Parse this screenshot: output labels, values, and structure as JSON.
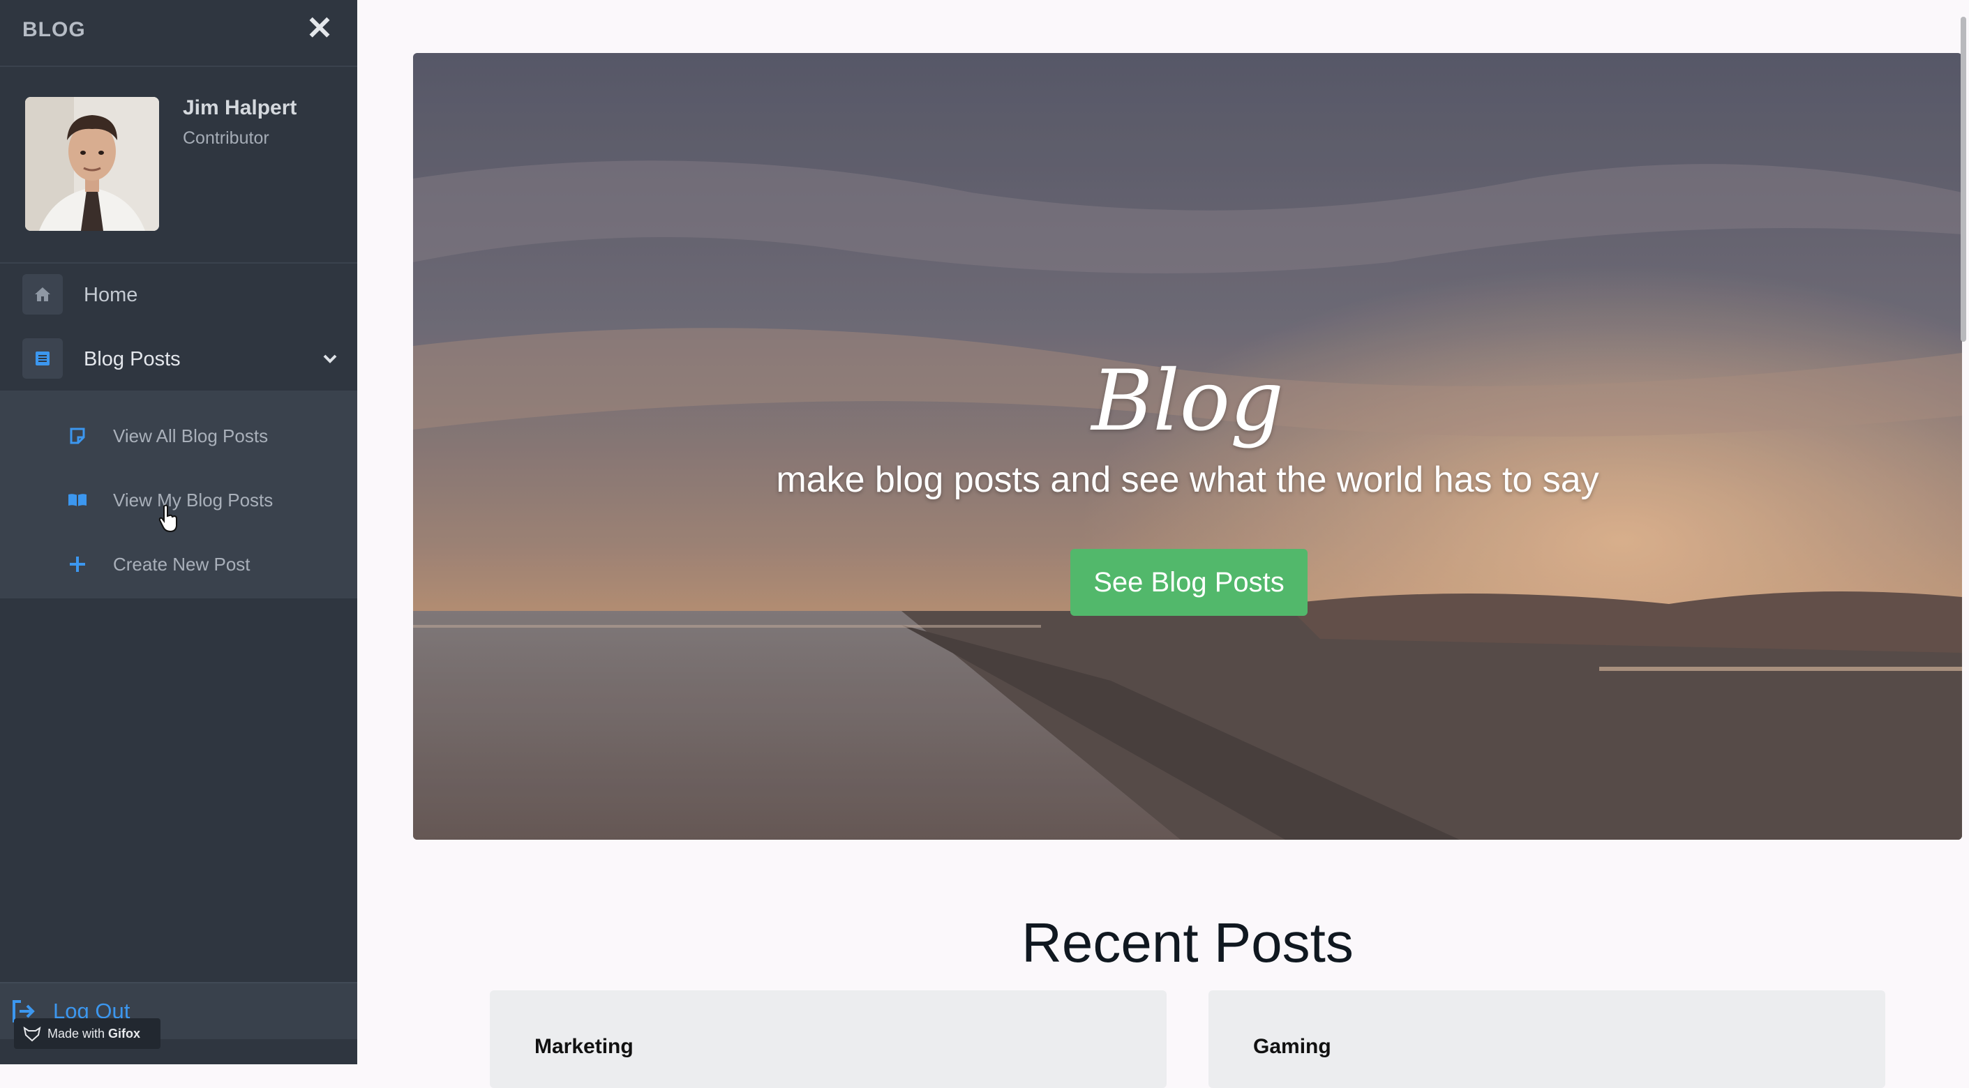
{
  "sidebar": {
    "brand": "BLOG",
    "close_icon": "close-icon",
    "profile": {
      "name": "Jim Halpert",
      "role": "Contributor"
    },
    "nav": [
      {
        "label": "Home",
        "icon": "home-icon"
      },
      {
        "label": "Blog Posts",
        "icon": "list-icon",
        "expanded": true
      }
    ],
    "submenu": [
      {
        "label": "View All Blog Posts",
        "icon": "note-icon"
      },
      {
        "label": "View My Blog Posts",
        "icon": "book-icon"
      },
      {
        "label": "Create New Post",
        "icon": "plus-icon"
      }
    ],
    "logout": {
      "label": "Log Out",
      "icon": "sign-out-icon"
    },
    "watermark": {
      "prefix": "Made with",
      "brand": "Gifox"
    }
  },
  "hero": {
    "title": "Blog",
    "subtitle": "make blog posts and see what the world has to say",
    "button_label": "See Blog Posts"
  },
  "recent": {
    "title": "Recent Posts",
    "cards": [
      {
        "category": "Marketing"
      },
      {
        "category": "Gaming"
      }
    ]
  },
  "colors": {
    "sidebar_bg": "#2f3640",
    "accent_blue": "#3c97ef",
    "button_green": "#52b86b",
    "page_bg": "#fbf8fb"
  }
}
